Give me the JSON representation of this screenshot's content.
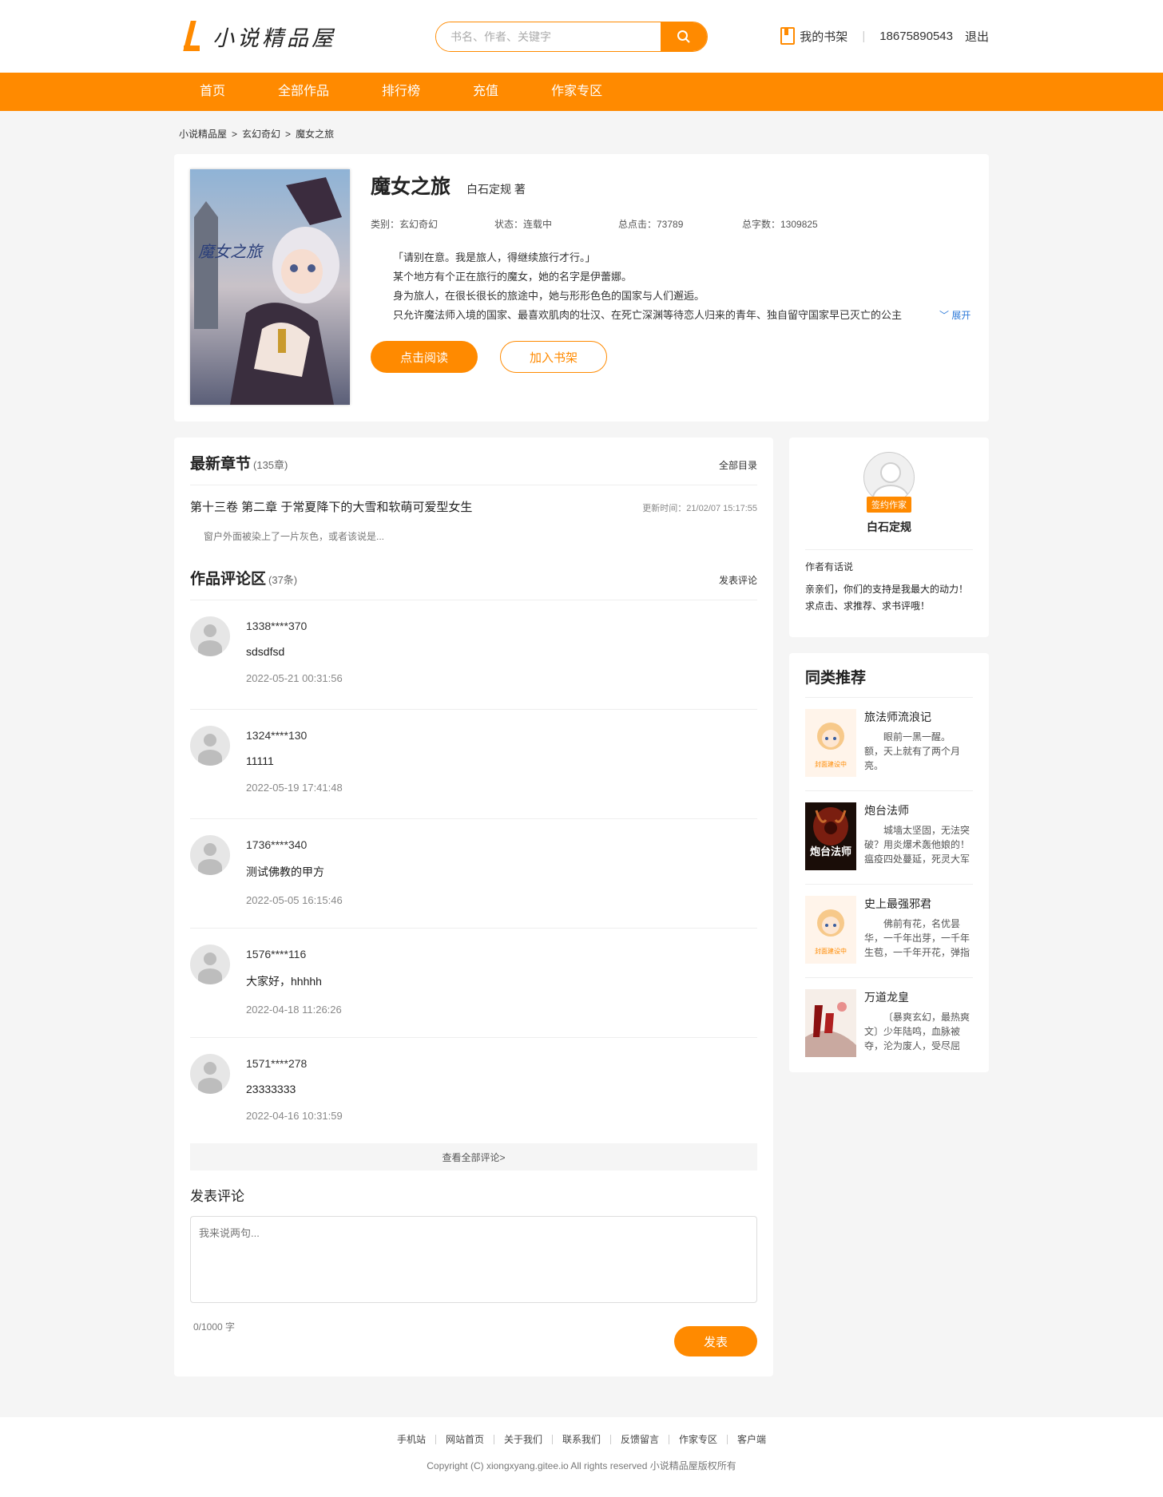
{
  "header": {
    "logo_text": "小说精品屋",
    "search_placeholder": "书名、作者、关键字",
    "bookshelf_label": "我的书架",
    "phone": "18675890543",
    "logout": "退出"
  },
  "nav": [
    "首页",
    "全部作品",
    "排行榜",
    "充值",
    "作家专区"
  ],
  "breadcrumb": [
    "小说精品屋",
    "玄幻奇幻",
    "魔女之旅"
  ],
  "book": {
    "title": "魔女之旅",
    "author": "白石定规 著",
    "category": "类别：玄幻奇幻",
    "status": "状态：连载中",
    "clicks": "总点击：73789",
    "words": "总字数：1309825",
    "intro": [
      "「请别在意。我是旅人，得继续旅行才行。」",
      "某个地方有个正在旅行的魔女，她的名字是伊蕾娜。",
      "身为旅人，在很长很长的旅途中，她与形形色色的国家与人们邂逅。",
      "只允许魔法师入境的国家、最喜欢肌肉的壮汉、在死亡深渊等待恋人归来的青年、独自留守国家早已灭亡的公主"
    ],
    "expand": "展开",
    "read_btn": "点击阅读",
    "shelf_btn": "加入书架"
  },
  "latest": {
    "title": "最新章节",
    "count": "(135章)",
    "all_link": "全部目录",
    "chapter_title": "第十三卷 第二章 于常夏降下的大雪和软萌可爱型女生",
    "update_time": "更新时间：21/02/07 15:17:55",
    "excerpt": "窗户外面被染上了一片灰色，或者该说是..."
  },
  "comments": {
    "title": "作品评论区",
    "count": "(37条)",
    "post_link": "发表评论",
    "items": [
      {
        "user": "1338****370",
        "text": "sdsdfsd",
        "time": "2022-05-21 00:31:56"
      },
      {
        "user": "1324****130",
        "text": "11111",
        "time": "2022-05-19 17:41:48"
      },
      {
        "user": "1736****340",
        "text": "测试佛教的甲方",
        "time": "2022-05-05 16:15:46"
      },
      {
        "user": "1576****116",
        "text": "大家好，hhhhh",
        "time": "2022-04-18 11:26:26"
      },
      {
        "user": "1571****278",
        "text": "23333333",
        "time": "2022-04-16 10:31:59"
      }
    ],
    "view_all": "查看全部评论>",
    "post_title": "发表评论",
    "post_placeholder": "我来说两句...",
    "counter": "0/1000 字",
    "submit": "发表"
  },
  "author_panel": {
    "badge": "签约作家",
    "name": "白石定规",
    "says_label": "作者有话说",
    "says": "亲亲们，你们的支持是我最大的动力！求点击、求推荐、求书评哦！"
  },
  "recommend": {
    "title": "同类推荐",
    "items": [
      {
        "name": "旅法师流浪记",
        "desc": "眼前一黑一醒。　　额，天上就有了两个月亮。"
      },
      {
        "name": "炮台法师",
        "desc": "城墙太坚固，无法突破？用炎爆术轰他娘的！瘟疫四处蔓延，死灵大军"
      },
      {
        "name": "史上最强邪君",
        "desc": "佛前有花，名优昙华，一千年出芽，一千年生苞，一千年开花，弹指"
      },
      {
        "name": "万道龙皇",
        "desc": "〔暴爽玄幻，最热爽文〕少年陆鸣，血脉被夺，沦为废人，受尽屈"
      }
    ],
    "cover_placeholder": "封面建设中",
    "cover_pt": "炮台法师"
  },
  "footer": {
    "links": [
      "手机站",
      "网站首页",
      "关于我们",
      "联系我们",
      "反馈留言",
      "作家专区",
      "客户端"
    ],
    "copyright": "Copyright (C) xiongxyang.gitee.io All rights reserved  小说精品屋版权所有"
  },
  "colors": {
    "accent": "#ff8a00",
    "link": "#2f7bd9"
  }
}
